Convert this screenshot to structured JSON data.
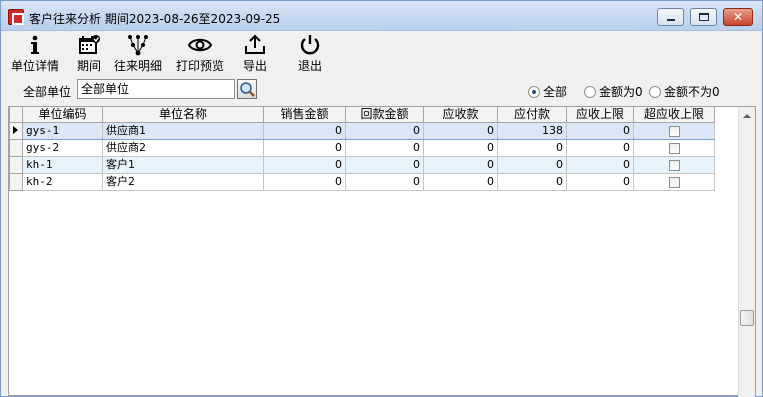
{
  "window": {
    "title": "客户往来分析 期间2023-08-26至2023-09-25"
  },
  "toolbar": {
    "items": [
      {
        "label": "单位详情",
        "icon": "info-icon"
      },
      {
        "label": "期间",
        "icon": "calendar-icon"
      },
      {
        "label": "往来明细",
        "icon": "network-icon"
      },
      {
        "label": "打印预览",
        "icon": "eye-icon"
      },
      {
        "label": "导出",
        "icon": "export-icon"
      },
      {
        "label": "退出",
        "icon": "power-icon"
      }
    ]
  },
  "filter": {
    "label": "全部单位",
    "value": "全部单位",
    "radios": [
      {
        "label": "全部",
        "checked": true
      },
      {
        "label": "金额为0",
        "checked": false
      },
      {
        "label": "金额不为0",
        "checked": false
      }
    ]
  },
  "grid": {
    "columns": [
      "单位编码",
      "单位名称",
      "销售金额",
      "回款金额",
      "应收款",
      "应付款",
      "应收上限",
      "超应收上限"
    ],
    "rows": [
      {
        "code": "gys-1",
        "name": "供应商1",
        "sales": "0",
        "payback": "0",
        "receivable": "0",
        "payable": "138",
        "limit": "0",
        "over": false
      },
      {
        "code": "gys-2",
        "name": "供应商2",
        "sales": "0",
        "payback": "0",
        "receivable": "0",
        "payable": "0",
        "limit": "0",
        "over": false
      },
      {
        "code": "kh-1",
        "name": "客户1",
        "sales": "0",
        "payback": "0",
        "receivable": "0",
        "payable": "0",
        "limit": "0",
        "over": false
      },
      {
        "code": "kh-2",
        "name": "客户2",
        "sales": "0",
        "payback": "0",
        "receivable": "0",
        "payable": "0",
        "limit": "0",
        "over": false
      }
    ]
  },
  "colors": {
    "selected_row": "#dbe6f6",
    "alt_row": "#e8f4fb",
    "close_button": "#c8452c"
  }
}
